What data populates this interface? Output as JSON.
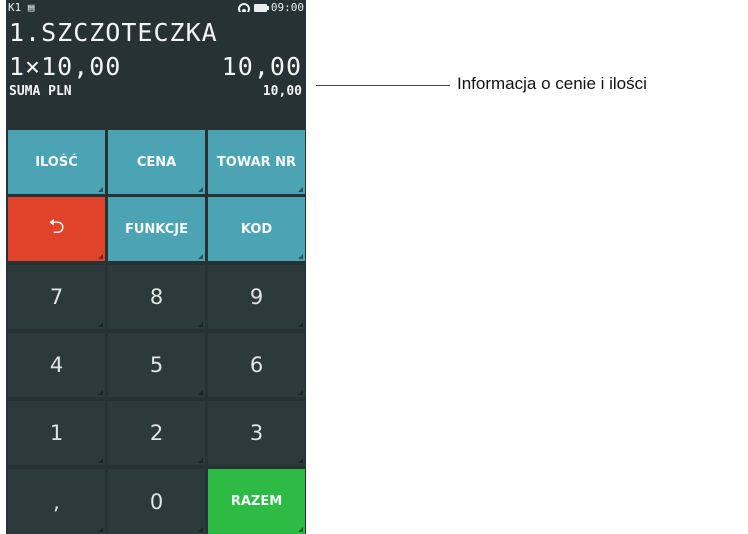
{
  "status": {
    "left": "K1",
    "left_icon": "receipt-icon",
    "time": "09:00"
  },
  "display": {
    "line1": "1.SZCZOTECZKA",
    "qty_price": "1×10,00",
    "line_total": "10,00",
    "sum_label": "SUMA PLN",
    "sum_value": "10,00"
  },
  "keys": {
    "ilosc": "ILOŚĆ",
    "cena": "CENA",
    "towar_nr": "TOWAR NR",
    "back": "⮌",
    "funkcje": "FUNKCJE",
    "kod": "KOD",
    "n7": "7",
    "n8": "8",
    "n9": "9",
    "n4": "4",
    "n5": "5",
    "n6": "6",
    "n1": "1",
    "n2": "2",
    "n3": "3",
    "comma": ",",
    "n0": "0",
    "razem": "RAZEM"
  },
  "colors": {
    "function_key": "#4ba3b4",
    "back_key": "#e0432a",
    "total_key": "#2dbb46",
    "numeric_key": "#2c3a3c",
    "screen": "#263234"
  },
  "annotation": {
    "text": "Informacja o cenie i ilości"
  }
}
